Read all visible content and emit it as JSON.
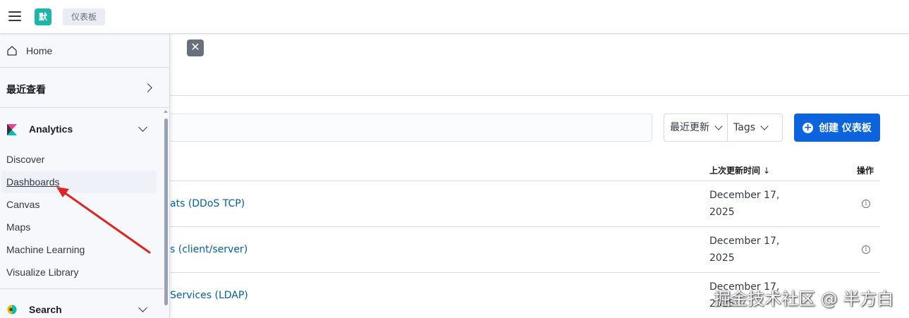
{
  "header": {
    "space_initial": "默",
    "breadcrumb": "仪表板"
  },
  "sidenav": {
    "home_label": "Home",
    "recent_label": "最近查看",
    "analytics": {
      "label": "Analytics",
      "items": [
        {
          "label": "Discover"
        },
        {
          "label": "Dashboards",
          "active": true
        },
        {
          "label": "Canvas"
        },
        {
          "label": "Maps"
        },
        {
          "label": "Machine Learning"
        },
        {
          "label": "Visualize Library"
        }
      ]
    },
    "search_label": "Search"
  },
  "toolbar": {
    "sort_label": "最近更新",
    "tags_label": "Tags",
    "create_label": "创建 仪表板"
  },
  "table": {
    "col_updated": "上次更新时间",
    "col_updated_sort": "↓",
    "col_actions": "操作",
    "rows": [
      {
        "title": "ats (DDoS TCP)",
        "date_line1": "December 17,",
        "date_line2": "2025"
      },
      {
        "title": "s (client/server)",
        "date_line1": "December 17,",
        "date_line2": "2025"
      },
      {
        "title": "Services (LDAP)",
        "date_line1": "December 17,",
        "date_line2": "2025"
      }
    ]
  },
  "watermark": "掘金技术社区 @ 半方白",
  "colors": {
    "accent": "#0b64dd",
    "link": "#0061a6",
    "space_avatar": "#1bb5a9",
    "annotation_arrow": "#e02424"
  }
}
